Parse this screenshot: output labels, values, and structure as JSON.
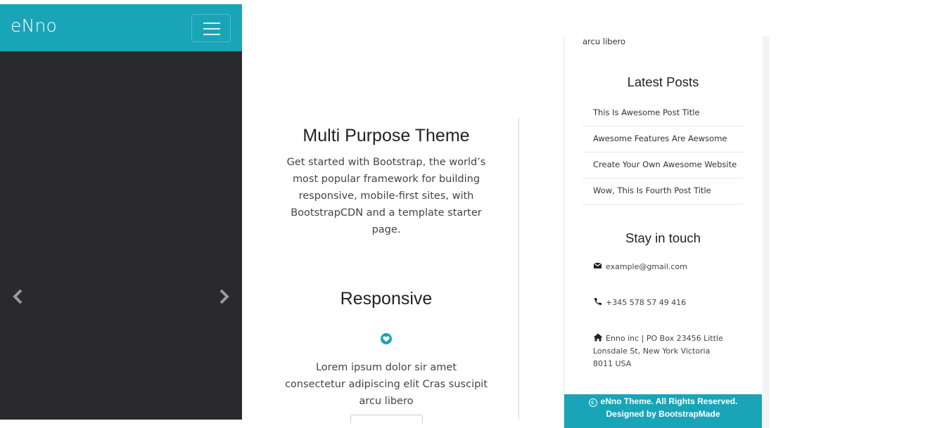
{
  "navbar": {
    "brand": "eNno",
    "accent_color": "#1aa4b8",
    "toggler_icon": "hamburger-menu-icon"
  },
  "carousel": {
    "prev_icon": "chevron-left-icon",
    "next_icon": "chevron-right-icon",
    "background_color": "#2a2a2c"
  },
  "main": {
    "feature1": {
      "title": "Multi Purpose Theme",
      "text": "Get started with Bootstrap, the world’s most popular framework for building responsive, mobile-first sites, with BootstrapCDN and a template starter page."
    },
    "feature2": {
      "title": "Responsive",
      "icon": "heart-icon",
      "text": "Lorem ipsum dolor sir amet consectetur adipiscing elit Cras suscipit arcu libero"
    }
  },
  "sidebar": {
    "top_text": "arcu libero",
    "latest_posts": {
      "heading": "Latest Posts",
      "items": [
        "This Is Awesome Post Title",
        "Awesome Features Are Aewsome",
        "Create Your Own Awesome Website",
        "Wow, This Is Fourth Post Title"
      ]
    },
    "contact": {
      "heading": "Stay in touch",
      "email": "example@gmail.com",
      "phone": "+345 578 57 49 416",
      "address": "Enno inc | PO Box 23456 Little Lonsdale St, New York Victoria 8011 USA"
    },
    "footer": {
      "line1": "eNno Theme. All Rights Reserved.",
      "line2": "Designed by BootstrapMade",
      "copyright_icon": "copyright-icon"
    }
  }
}
